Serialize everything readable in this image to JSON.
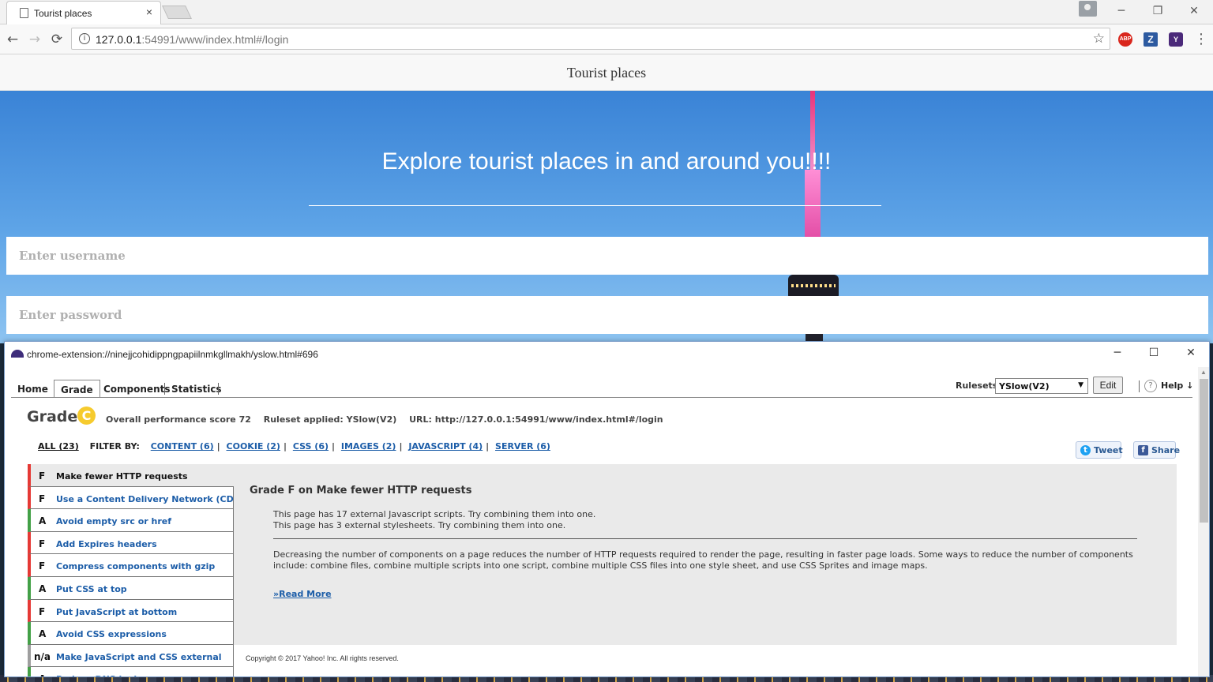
{
  "browser": {
    "tab_title": "Tourist places",
    "tab_close": "×",
    "url_host": "127.0.0.1",
    "url_rest": ":54991/www/index.html#/login",
    "window_controls": {
      "minimize": "─",
      "restore": "❐",
      "close": "✕"
    },
    "nav": {
      "back": "←",
      "forward": "→",
      "reload": "⟳"
    },
    "extensions": {
      "abp": "ABP",
      "z": "Z",
      "yslow": "Y"
    },
    "menu": "⋮",
    "star": "☆",
    "info": "i"
  },
  "page": {
    "header_title": "Tourist places",
    "headline": "Explore tourist places in and around you!!!!",
    "username_placeholder": "Enter username",
    "password_placeholder": "Enter password"
  },
  "yslow": {
    "window_title": "chrome-extension://ninejjcohidippngpapiilnmkgllmakh/yslow.html#696",
    "window_controls": {
      "minimize": "─",
      "maximize": "☐",
      "close": "✕"
    },
    "tabs": [
      "Home",
      "Grade",
      "Components",
      "Statistics"
    ],
    "rulesets_label": "Rulesets",
    "ruleset_selected": "YSlow(V2)",
    "ruleset_arrow": "▼",
    "edit_label": "Edit",
    "help_icon": "?",
    "help_label": "Help ↓",
    "grade_label": "Grade",
    "grade_value": "C",
    "overall_score": "Overall performance score 72",
    "ruleset_applied": "Ruleset applied: YSlow(V2)",
    "url_text": "URL: http://127.0.0.1:54991/www/index.html#/login",
    "filter": {
      "all": "ALL (23)",
      "label": "FILTER BY:",
      "items": [
        "CONTENT (6)",
        "COOKIE (2)",
        "CSS (6)",
        "IMAGES (2)",
        "JAVASCRIPT (4)",
        "SERVER (6)"
      ]
    },
    "tweet_label": "Tweet",
    "share_label": "Share",
    "tweet_icon": "t",
    "share_icon": "f",
    "rules": [
      {
        "grade": "F",
        "name": "Make fewer HTTP requests",
        "color": "#e53935"
      },
      {
        "grade": "F",
        "name": "Use a Content Delivery Network (CDN)",
        "color": "#e53935"
      },
      {
        "grade": "A",
        "name": "Avoid empty src or href",
        "color": "#43a047"
      },
      {
        "grade": "F",
        "name": "Add Expires headers",
        "color": "#e53935"
      },
      {
        "grade": "F",
        "name": "Compress components with gzip",
        "color": "#e53935"
      },
      {
        "grade": "A",
        "name": "Put CSS at top",
        "color": "#43a047"
      },
      {
        "grade": "F",
        "name": "Put JavaScript at bottom",
        "color": "#e53935"
      },
      {
        "grade": "A",
        "name": "Avoid CSS expressions",
        "color": "#43a047"
      },
      {
        "grade": "n/a",
        "name": "Make JavaScript and CSS external",
        "color": "#9e9e9e"
      },
      {
        "grade": "A",
        "name": "Reduce DNS lookups",
        "color": "#43a047"
      }
    ],
    "detail": {
      "title": "Grade F on Make fewer HTTP requests",
      "line1": "This page has 17 external Javascript scripts. Try combining them into one.",
      "line2": "This page has 3 external stylesheets. Try combining them into one.",
      "description": "Decreasing the number of components on a page reduces the number of HTTP requests required to render the page, resulting in faster page loads. Some ways to reduce the number of components include: combine files, combine multiple scripts into one script, combine multiple CSS files into one style sheet, and use CSS Sprites and image maps.",
      "read_more": "»Read More"
    },
    "copyright": "Copyright © 2017 Yahoo! Inc. All rights reserved."
  }
}
